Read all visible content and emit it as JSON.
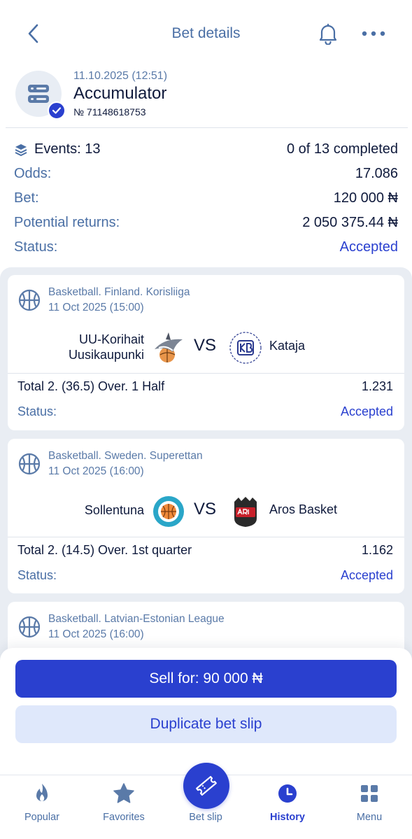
{
  "header": {
    "title": "Bet details",
    "back_icon": "chevron-left-icon",
    "notification_icon": "bell-icon",
    "more_icon": "more-dots-icon"
  },
  "bet": {
    "date": "11.10.2025 (12:51)",
    "type": "Accumulator",
    "number": "№ 71148618753"
  },
  "details": {
    "events_label": "Events: 13",
    "completed": "0 of 13 completed",
    "odds_label": "Odds:",
    "odds_value": "17.086",
    "bet_label": "Bet:",
    "bet_value": "120 000 ₦",
    "returns_label": "Potential returns:",
    "returns_value": "2 050 375.44 ₦",
    "status_label": "Status:",
    "status_value": "Accepted"
  },
  "events": [
    {
      "league": "Basketball. Finland. Korisliiga",
      "date": "11 Oct 2025 (15:00)",
      "team1": "UU-Korihait Uusikaupunki",
      "vs": "VS",
      "team2": "Kataja",
      "market": "Total 2. (36.5) Over. 1 Half",
      "odd": "1.231",
      "status_label": "Status:",
      "status": "Accepted"
    },
    {
      "league": "Basketball. Sweden. Superettan",
      "date": "11 Oct 2025 (16:00)",
      "team1": "Sollentuna",
      "vs": "VS",
      "team2": "Aros Basket",
      "market": "Total 2. (14.5) Over. 1st quarter",
      "odd": "1.162",
      "status_label": "Status:",
      "status": "Accepted"
    },
    {
      "league": "Basketball. Latvian-Estonian League",
      "date": "11 Oct 2025 (16:00)"
    }
  ],
  "actions": {
    "sell": "Sell for: 90 000 ₦",
    "duplicate": "Duplicate bet slip"
  },
  "nav": {
    "popular": "Popular",
    "favorites": "Favorites",
    "betslip": "Bet slip",
    "history": "History",
    "menu": "Menu"
  },
  "colors": {
    "accent": "#2a40cf",
    "muted_text": "#4a6fa5",
    "primary_text": "#0f1a3c",
    "list_background": "#e9edf3"
  }
}
